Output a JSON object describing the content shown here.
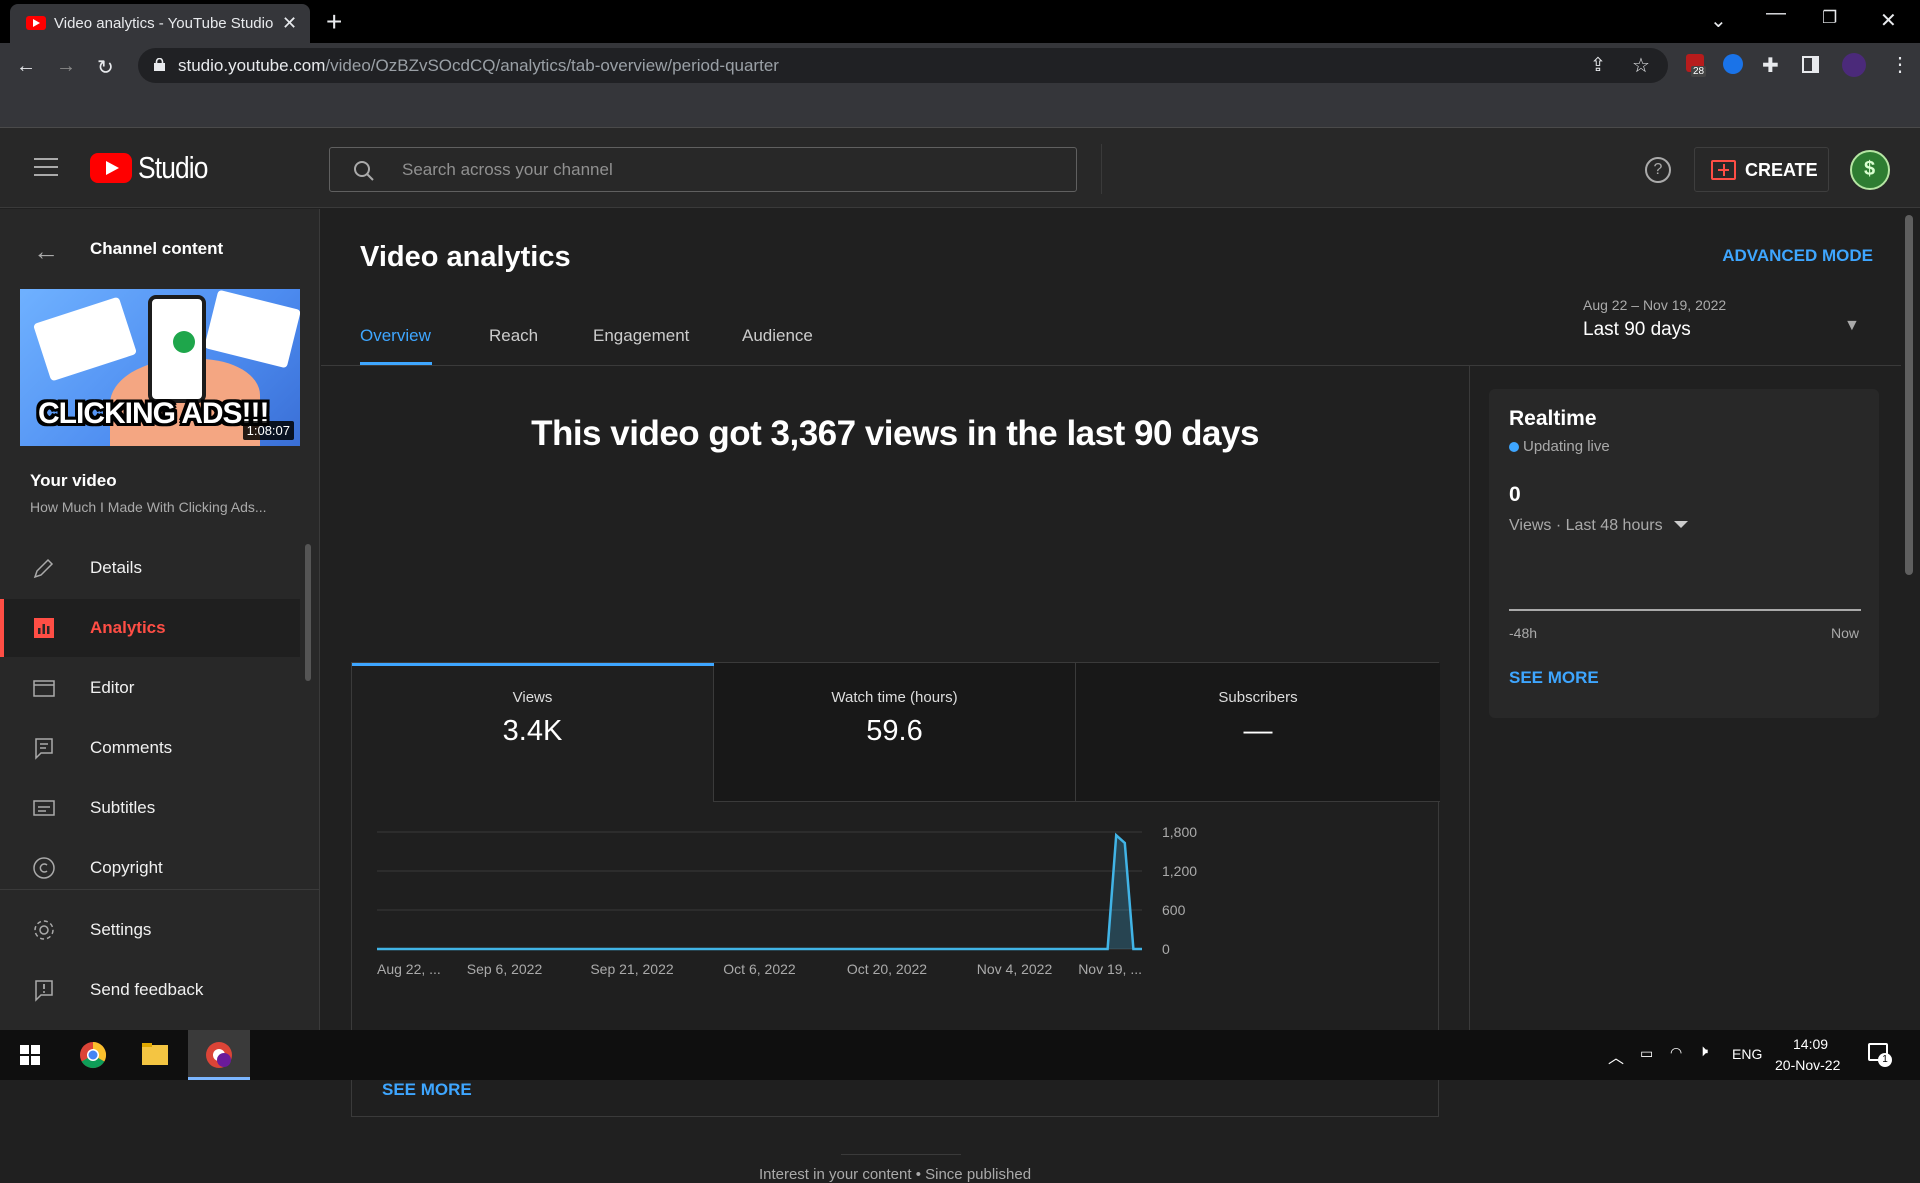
{
  "browser": {
    "tab_title": "Video analytics - YouTube Studio",
    "url_domain": "studio.youtube.com",
    "url_path": "/video/OzBZvSOcdCQ/analytics/tab-overview/period-quarter",
    "extension_badge": "28"
  },
  "header": {
    "logo_text": "Studio",
    "search_placeholder": "Search across your channel",
    "help_glyph": "?",
    "create_label": "CREATE"
  },
  "sidebar": {
    "section_title": "Channel content",
    "thumbnail_caption": "CLICKING ADS!!!",
    "thumbnail_duration": "1:08:07",
    "your_video_label": "Your video",
    "video_title": "How Much I Made With Clicking Ads...",
    "items": [
      {
        "label": "Details",
        "icon": "pencil-icon"
      },
      {
        "label": "Analytics",
        "icon": "analytics-icon",
        "active": true
      },
      {
        "label": "Editor",
        "icon": "clapperboard-icon"
      },
      {
        "label": "Comments",
        "icon": "comments-icon"
      },
      {
        "label": "Subtitles",
        "icon": "subtitles-icon"
      },
      {
        "label": "Copyright",
        "icon": "copyright-icon"
      },
      {
        "label": "Settings",
        "icon": "gear-icon"
      },
      {
        "label": "Send feedback",
        "icon": "feedback-icon"
      }
    ]
  },
  "main": {
    "title": "Video analytics",
    "advanced_mode": "ADVANCED MODE",
    "tabs": [
      "Overview",
      "Reach",
      "Engagement",
      "Audience"
    ],
    "date_range": "Aug 22 – Nov 19, 2022",
    "date_label": "Last 90 days",
    "headline": "This video got 3,367 views in the last 90 days",
    "metrics": [
      {
        "label": "Views",
        "value": "3.4K"
      },
      {
        "label": "Watch time (hours)",
        "value": "59.6"
      },
      {
        "label": "Subscribers",
        "value": "—"
      }
    ],
    "see_more": "SEE MORE",
    "interest": "Interest in your content • Since published"
  },
  "chart_data": {
    "type": "line",
    "x_labels": [
      "Aug 22, ...",
      "Sep 6, 2022",
      "Sep 21, 2022",
      "Oct 6, 2022",
      "Oct 20, 2022",
      "Nov 4, 2022",
      "Nov 19, ..."
    ],
    "y_ticks": [
      "1,800",
      "1,200",
      "600",
      "0"
    ],
    "ylim": [
      0,
      1800
    ],
    "grid": true,
    "series": [
      {
        "color": "#41b4e6",
        "points": [
          {
            "x": "Aug 22",
            "y": 0
          },
          {
            "x": "Nov 15",
            "y": 0
          },
          {
            "x": "Nov 16",
            "y": 1750
          },
          {
            "x": "Nov 17",
            "y": 1630
          },
          {
            "x": "Nov 18",
            "y": 0
          },
          {
            "x": "Nov 19",
            "y": 0
          }
        ]
      }
    ]
  },
  "realtime": {
    "title": "Realtime",
    "status": "Updating live",
    "value": "0",
    "views_label": "Views · Last 48 hours",
    "left_label": "-48h",
    "right_label": "Now",
    "see_more": "SEE MORE"
  },
  "taskbar": {
    "lang": "ENG",
    "time": "14:09",
    "date": "20-Nov-22",
    "notification_count": "1"
  }
}
